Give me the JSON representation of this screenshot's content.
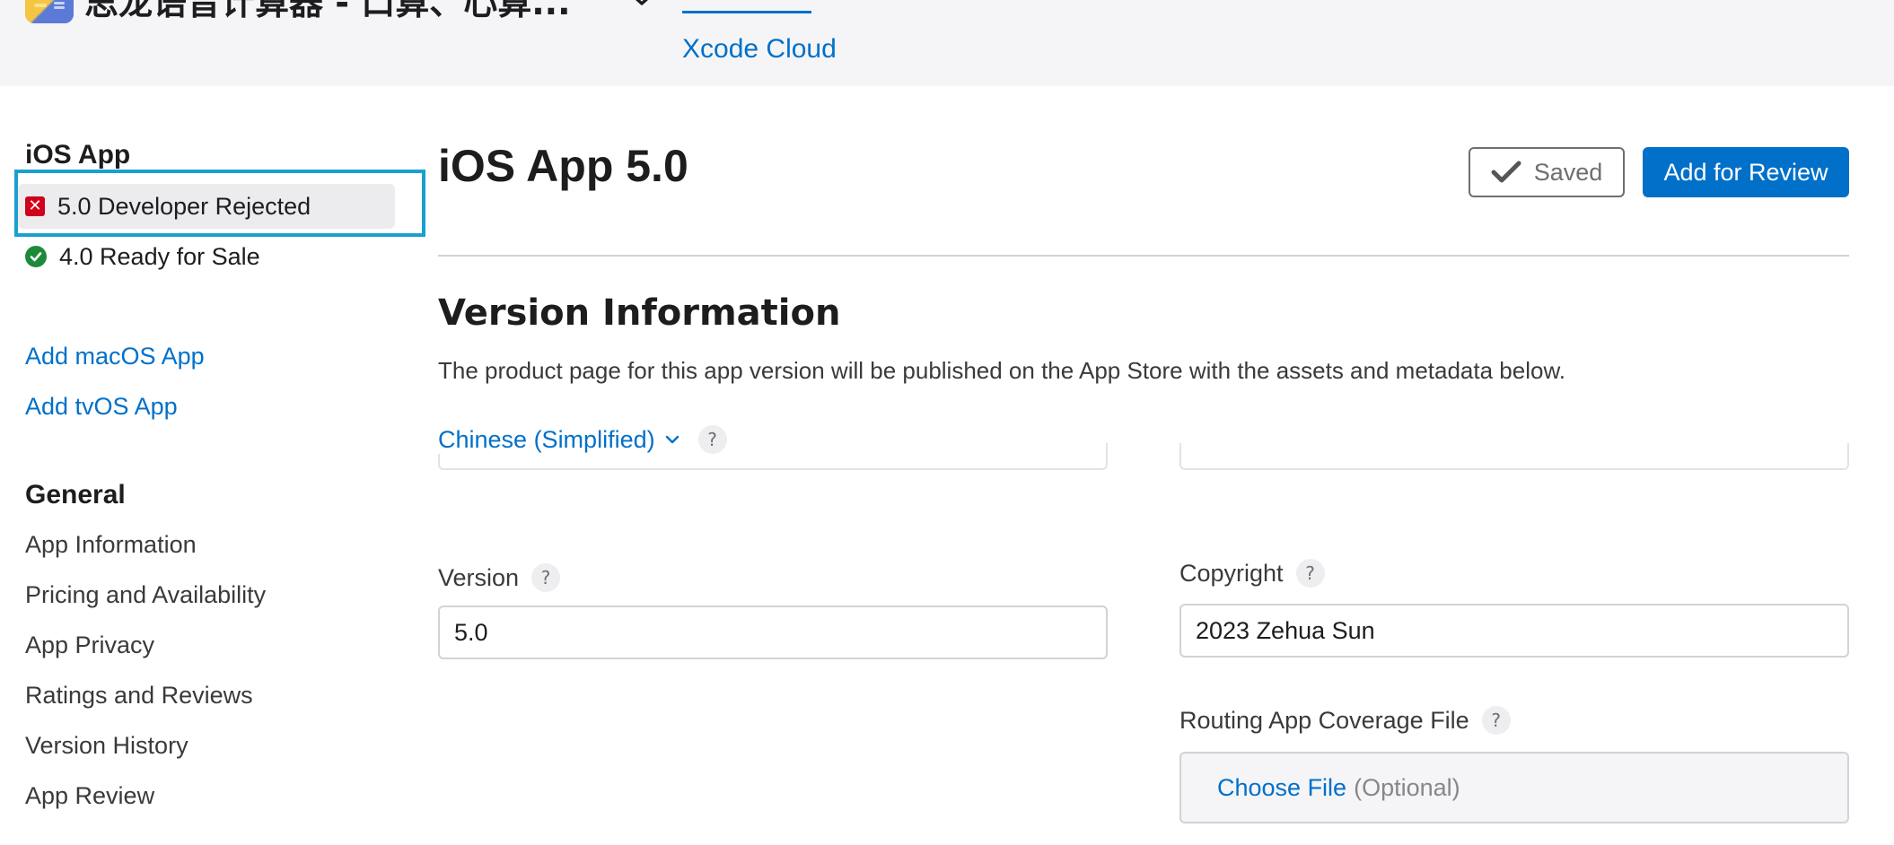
{
  "header": {
    "app_title": "思龙语音计算器 - 口算、心算...",
    "active_tab": "Xcode Cloud"
  },
  "sidebar": {
    "ios_heading": "iOS App",
    "versions": [
      {
        "label": "5.0 Developer Rejected",
        "status": "rejected",
        "selected": true
      },
      {
        "label": "4.0 Ready for Sale",
        "status": "ready",
        "selected": false
      }
    ],
    "add_links": [
      "Add macOS App",
      "Add tvOS App"
    ],
    "general_heading": "General",
    "general_items": [
      "App Information",
      "Pricing and Availability",
      "App Privacy",
      "Ratings and Reviews",
      "Version History",
      "App Review"
    ]
  },
  "main": {
    "title": "iOS App 5.0",
    "saved_label": "Saved",
    "review_label": "Add for Review",
    "section_title": "Version Information",
    "section_desc": "The product page for this app version will be published on the App Store with the assets and metadata below.",
    "language": "Chinese (Simplified)",
    "version_label": "Version",
    "version_value": "5.0",
    "copyright_label": "Copyright",
    "copyright_value": "2023 Zehua Sun",
    "routing_label": "Routing App Coverage File",
    "choose_file": "Choose File",
    "optional": "(Optional)",
    "help_glyph": "?"
  },
  "colors": {
    "accent": "#0070c9",
    "rejected": "#d0021b",
    "ready": "#1d8a3a",
    "highlight": "#1aa0d0"
  }
}
